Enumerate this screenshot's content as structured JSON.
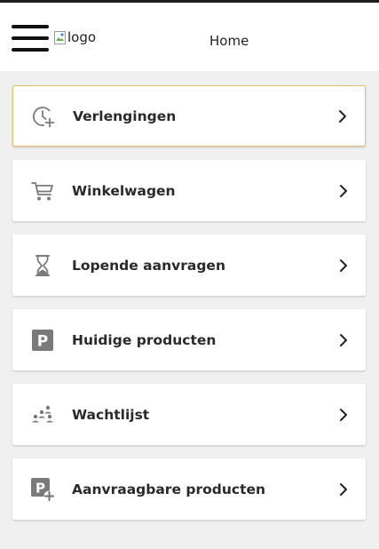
{
  "header": {
    "logo_alt": "logo",
    "title": "Home"
  },
  "menu": {
    "items": [
      {
        "label": "Verlengingen",
        "icon": "renewal-clock-icon"
      },
      {
        "label": "Winkelwagen",
        "icon": "cart-icon"
      },
      {
        "label": "Lopende aanvragen",
        "icon": "hourglass-icon"
      },
      {
        "label": "Huidige producten",
        "icon": "parking-icon"
      },
      {
        "label": "Wachtlijst",
        "icon": "waitlist-people-icon"
      },
      {
        "label": "Aanvraagbare producten",
        "icon": "parking-add-icon"
      }
    ]
  },
  "colors": {
    "accent_border": "#e3c270",
    "icon_gray": "#7a7a7a",
    "background": "#f0f0f0"
  }
}
